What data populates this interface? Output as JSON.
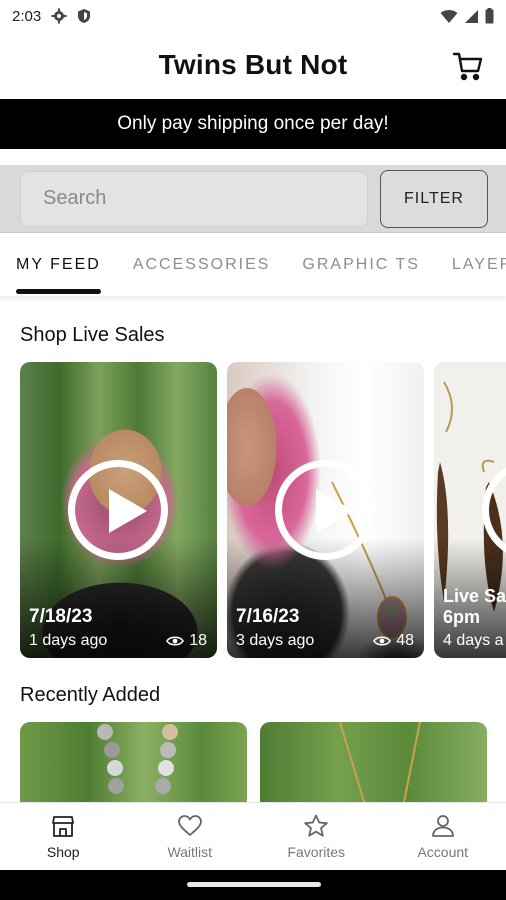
{
  "status_bar": {
    "time": "2:03"
  },
  "header": {
    "title": "Twins But Not"
  },
  "promo": {
    "text": "Only pay shipping once per day!"
  },
  "search": {
    "placeholder": "Search",
    "filter_label": "FILTER"
  },
  "tabs": [
    {
      "label": "MY FEED",
      "active": true
    },
    {
      "label": "ACCESSORIES",
      "active": false
    },
    {
      "label": "GRAPHIC TS",
      "active": false
    },
    {
      "label": "LAYER",
      "active": false
    }
  ],
  "live_sales": {
    "title": "Shop Live Sales",
    "cards": [
      {
        "date": "7/18/23",
        "ago": "1 days ago",
        "views": "18"
      },
      {
        "date": "7/16/23",
        "ago": "3 days ago",
        "views": "48"
      },
      {
        "title": "Live Sa",
        "title2": "6pm",
        "ago": "4 days a"
      }
    ]
  },
  "recently_added": {
    "title": "Recently Added"
  },
  "bottom_nav": [
    {
      "label": "Shop",
      "icon": "store-icon",
      "active": true
    },
    {
      "label": "Waitlist",
      "icon": "heart-icon",
      "active": false
    },
    {
      "label": "Favorites",
      "icon": "star-icon",
      "active": false
    },
    {
      "label": "Account",
      "icon": "person-icon",
      "active": false
    }
  ],
  "colors": {
    "banner_bg": "#000000",
    "search_bg": "#d9d9d9",
    "active_tab": "#111111",
    "inactive_tab": "#8d8d8d"
  }
}
